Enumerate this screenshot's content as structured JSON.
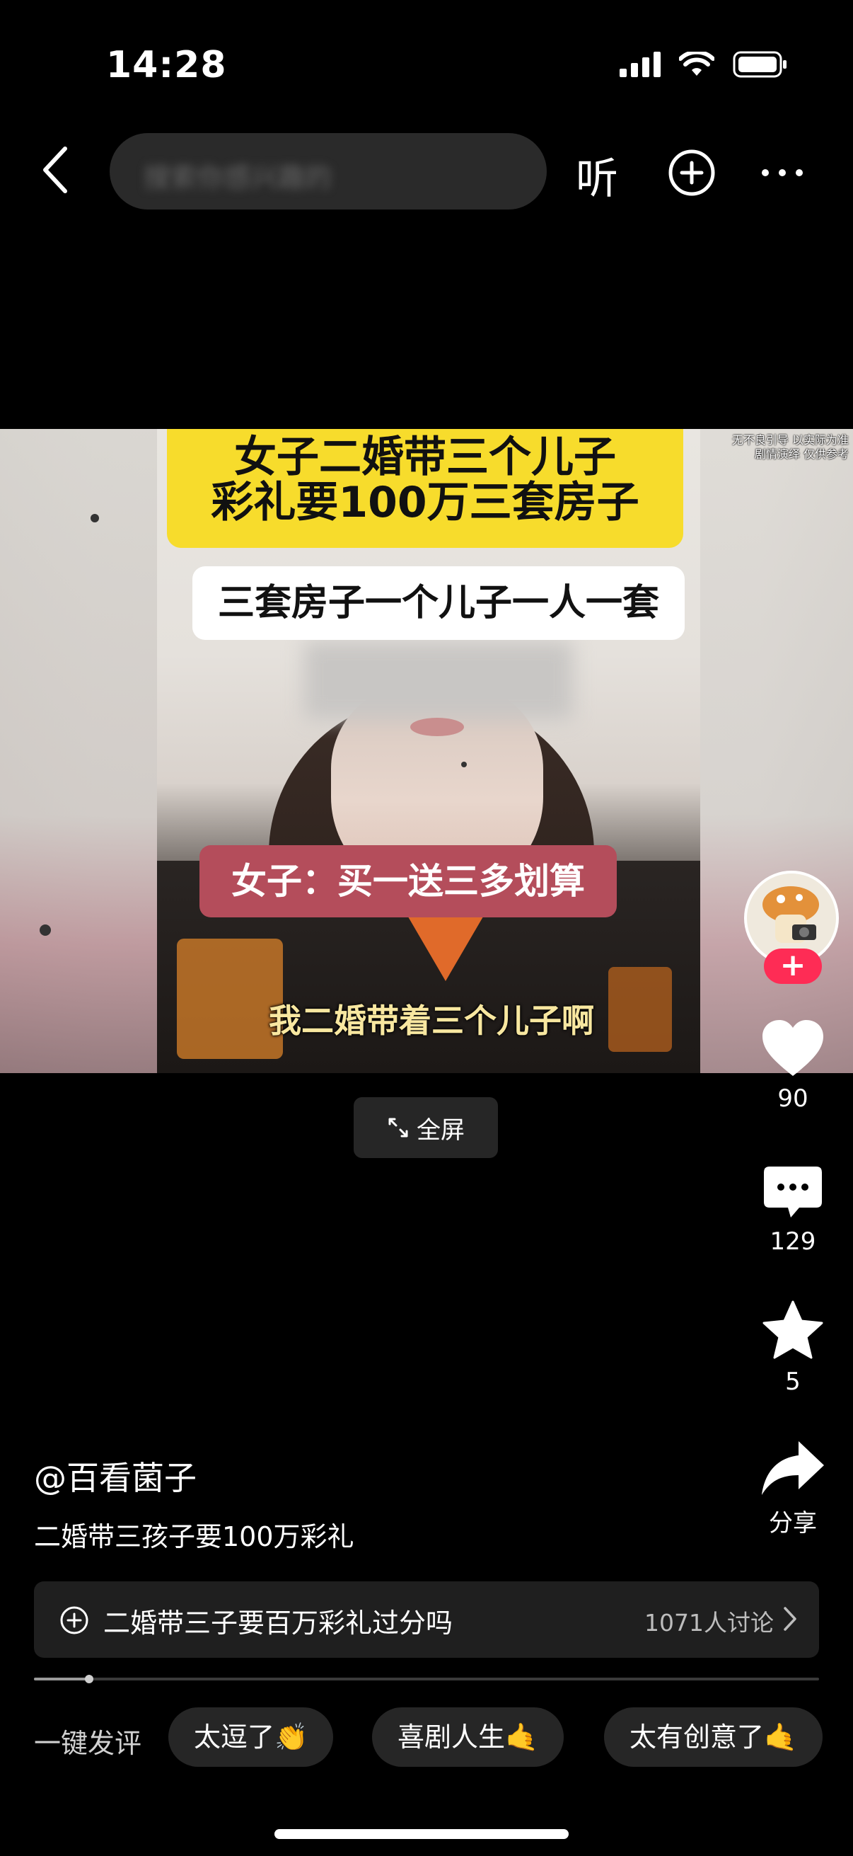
{
  "status_bar": {
    "time": "14:28"
  },
  "nav": {
    "search_placeholder": "搜索你感兴趣的",
    "listen_label": "听"
  },
  "video": {
    "caption_yellow_line1": "女子二婚带三个儿子",
    "caption_yellow_line2": "彩礼要100万三套房子",
    "caption_white": "三套房子一个儿子一人一套",
    "caption_pink": "女子：买一送三多划算",
    "subtitle": "我二婚带着三个儿子啊",
    "corner_note_line1": "无不良引导 以实际为准",
    "corner_note_line2": "剧情演绎 仅供参考"
  },
  "fullscreen_label": "全屏",
  "rail": {
    "follow_symbol": "+",
    "likes": "90",
    "comments": "129",
    "favorites": "5",
    "share_label": "分享"
  },
  "post": {
    "author": "@百看菌子",
    "description": "二婚带三孩子要100万彩礼"
  },
  "topic": {
    "text": "二婚带三子要百万彩礼过分吗",
    "count": "1071人讨论"
  },
  "progress": {
    "fraction": 0.07
  },
  "quick_comment": {
    "label": "一键发评",
    "chips": [
      "太逗了👏",
      "喜剧人生🤙",
      "太有创意了🤙"
    ]
  },
  "colors": {
    "accent_follow": "#fe2c55",
    "caption_yellow": "#f7dc2c",
    "caption_pink": "#b44d5b"
  },
  "icons": [
    "back-icon",
    "add-icon",
    "more-icon",
    "signal-icon",
    "wifi-icon",
    "battery-icon",
    "heart-icon",
    "comment-icon",
    "star-icon",
    "share-icon",
    "expand-icon",
    "plus-circle-icon",
    "chevron-right-icon"
  ]
}
